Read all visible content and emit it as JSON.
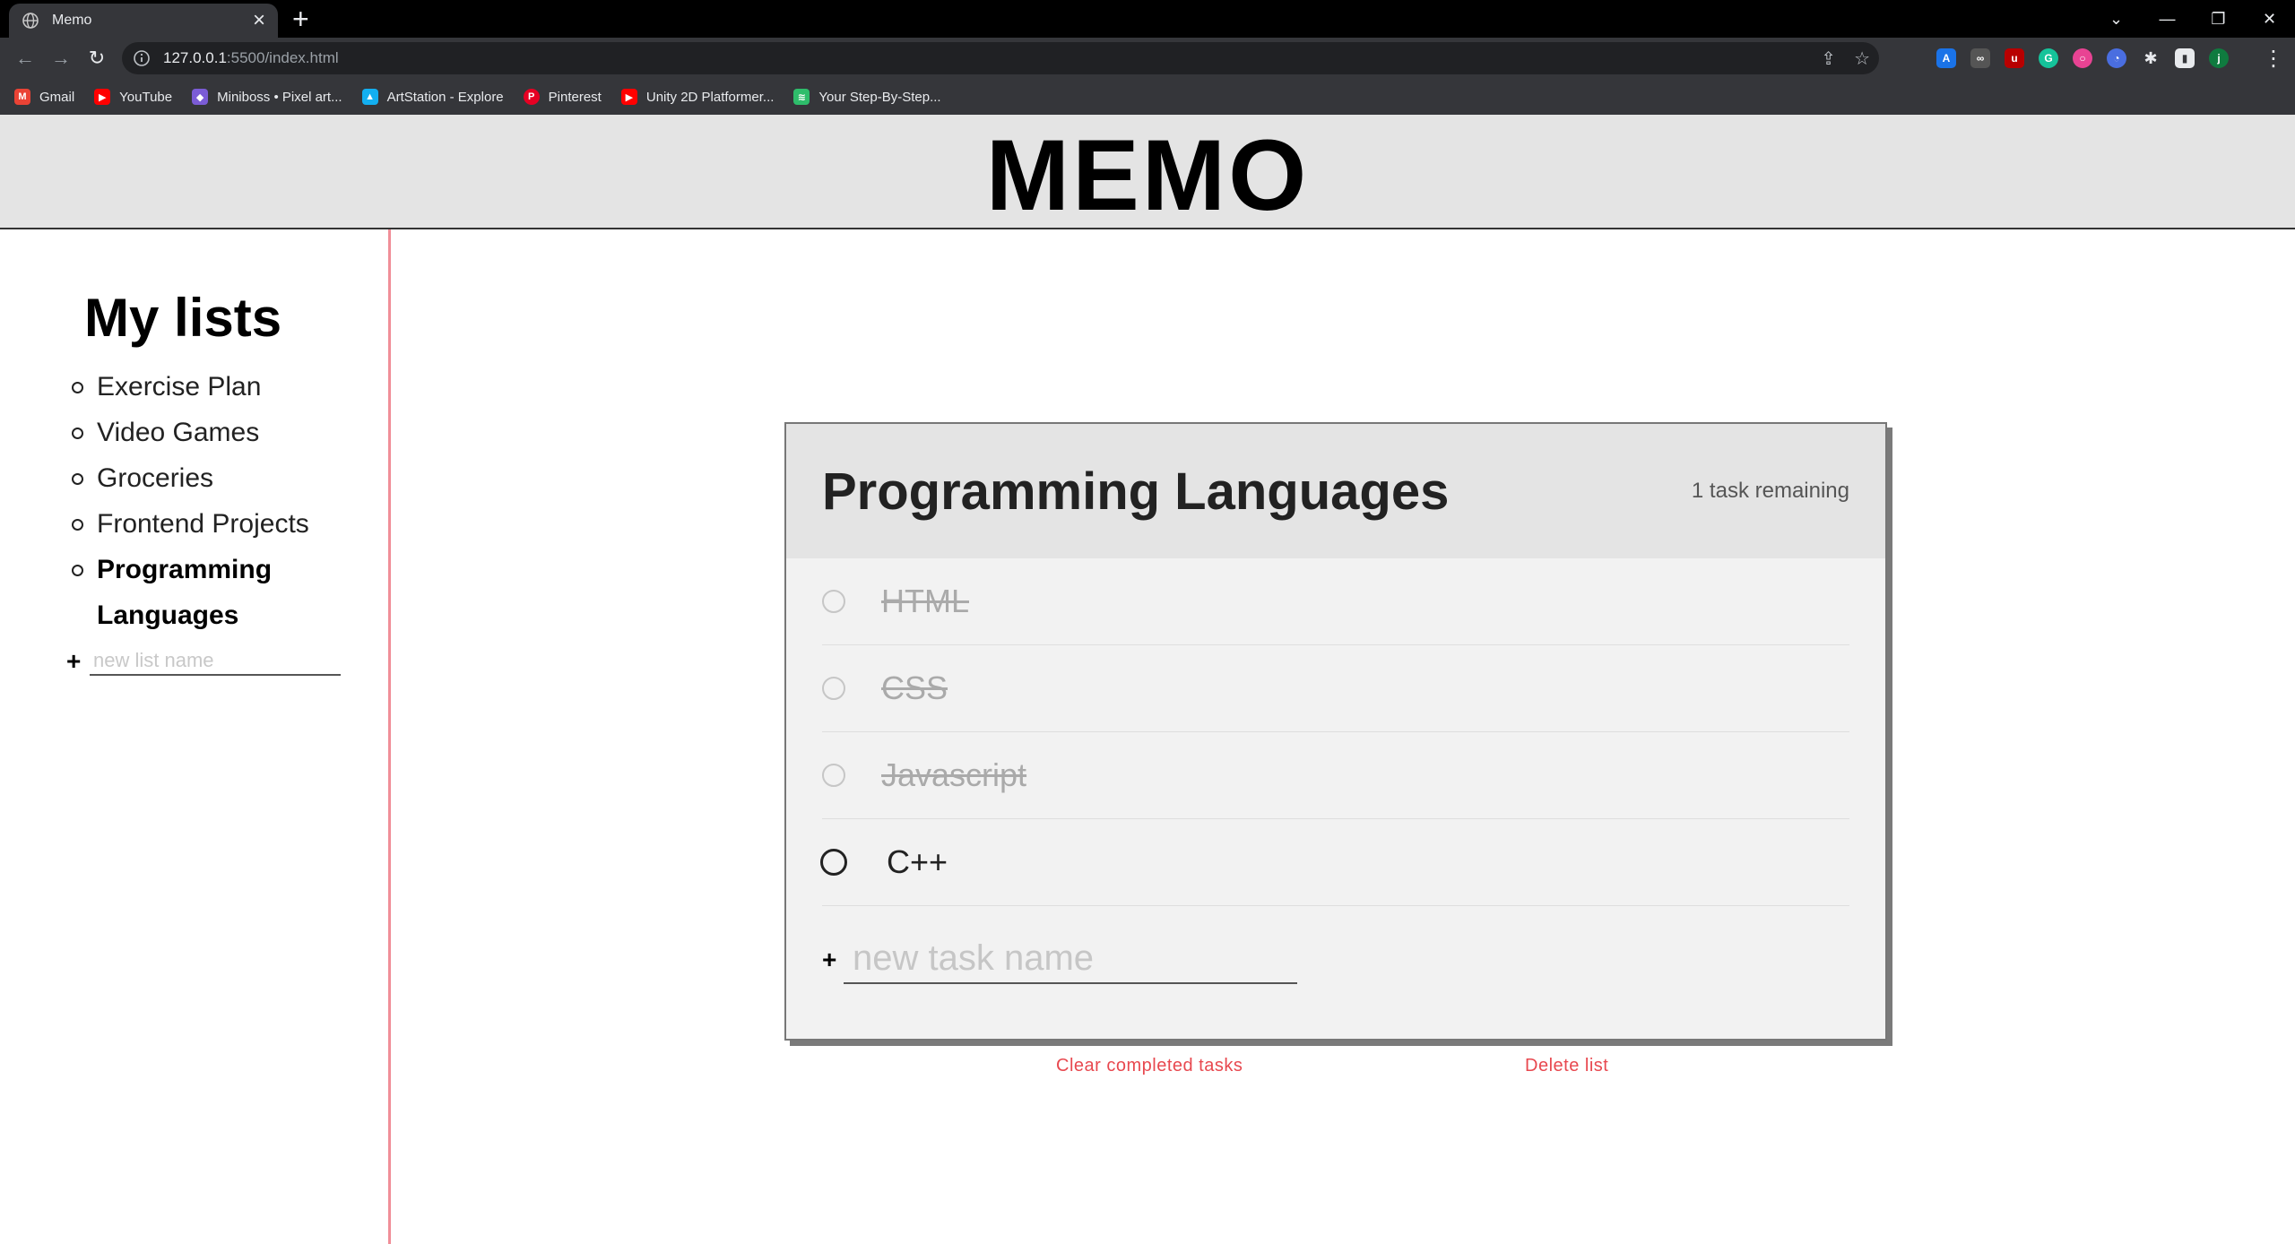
{
  "browser": {
    "tab_title": "Memo",
    "url_host": "127.0.0.1",
    "url_path": ":5500/index.html",
    "bookmarks": [
      {
        "label": "Gmail",
        "icon": "gmail-icon",
        "color": "#ea4335"
      },
      {
        "label": "YouTube",
        "icon": "youtube-icon",
        "color": "#ff0000"
      },
      {
        "label": "Miniboss • Pixel art...",
        "icon": "miniboss-icon",
        "color": "#7b5cd6"
      },
      {
        "label": "ArtStation - Explore",
        "icon": "artstation-icon",
        "color": "#13aff0"
      },
      {
        "label": "Pinterest",
        "icon": "pinterest-icon",
        "color": "#e60023"
      },
      {
        "label": "Unity 2D Platformer...",
        "icon": "youtube-icon",
        "color": "#ff0000"
      },
      {
        "label": "Your Step-By-Step...",
        "icon": "layers-icon",
        "color": "#2ebd6b"
      }
    ]
  },
  "header": {
    "title": "MEMO"
  },
  "sidebar": {
    "title": "My lists",
    "lists": [
      {
        "label": "Exercise Plan",
        "active": false
      },
      {
        "label": "Video Games",
        "active": false
      },
      {
        "label": "Groceries",
        "active": false
      },
      {
        "label": "Frontend Projects",
        "active": false
      },
      {
        "label": "Programming Languages",
        "active": true
      }
    ],
    "new_list_placeholder": "new list name"
  },
  "todo": {
    "title": "Programming Languages",
    "count": "1 task remaining",
    "tasks": [
      {
        "label": "HTML",
        "completed": true
      },
      {
        "label": "CSS",
        "completed": true
      },
      {
        "label": "Javascript",
        "completed": true
      },
      {
        "label": "C++",
        "completed": false
      }
    ],
    "new_task_placeholder": "new task name"
  },
  "actions": {
    "clear_label": "Clear completed tasks",
    "delete_label": "Delete list"
  },
  "colors": {
    "accent": "#e8484f",
    "divider": "#f08e98",
    "header_bg": "#e4e4e4"
  }
}
